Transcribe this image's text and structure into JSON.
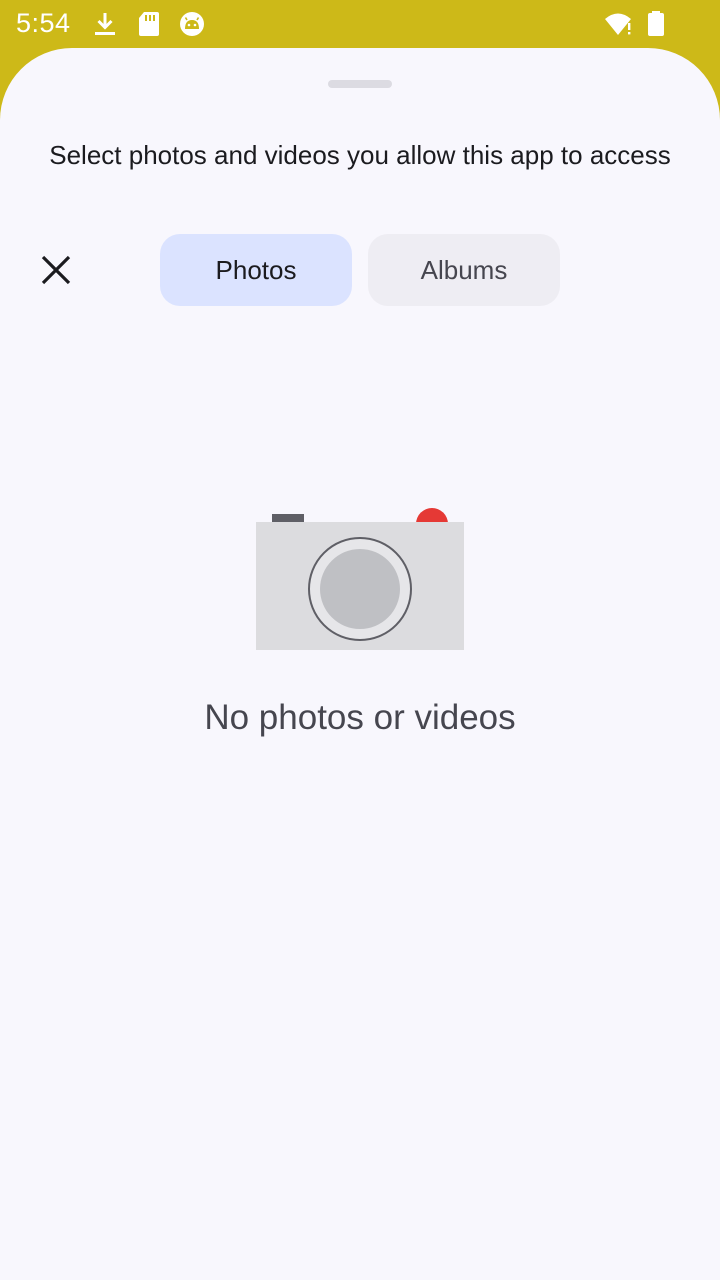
{
  "status_bar": {
    "time": "5:54",
    "icons": [
      "download-icon",
      "sd-card-icon",
      "android-head-icon",
      "wifi-alert-icon",
      "battery-icon"
    ]
  },
  "picker": {
    "prompt": "Select photos and videos you allow this app to access",
    "close_icon": "close-icon",
    "tabs": [
      {
        "label": "Photos",
        "selected": true
      },
      {
        "label": "Albums",
        "selected": false
      }
    ],
    "empty_state": {
      "icon": "camera-illustration",
      "message": "No photos or videos"
    }
  },
  "colors": {
    "status_bar": "#cdb918",
    "sheet_background": "#f8f7fd",
    "tab_selected": "#dbe3ff",
    "tab_unselected": "#eeedf3",
    "camera_record_dot": "#e53935"
  }
}
